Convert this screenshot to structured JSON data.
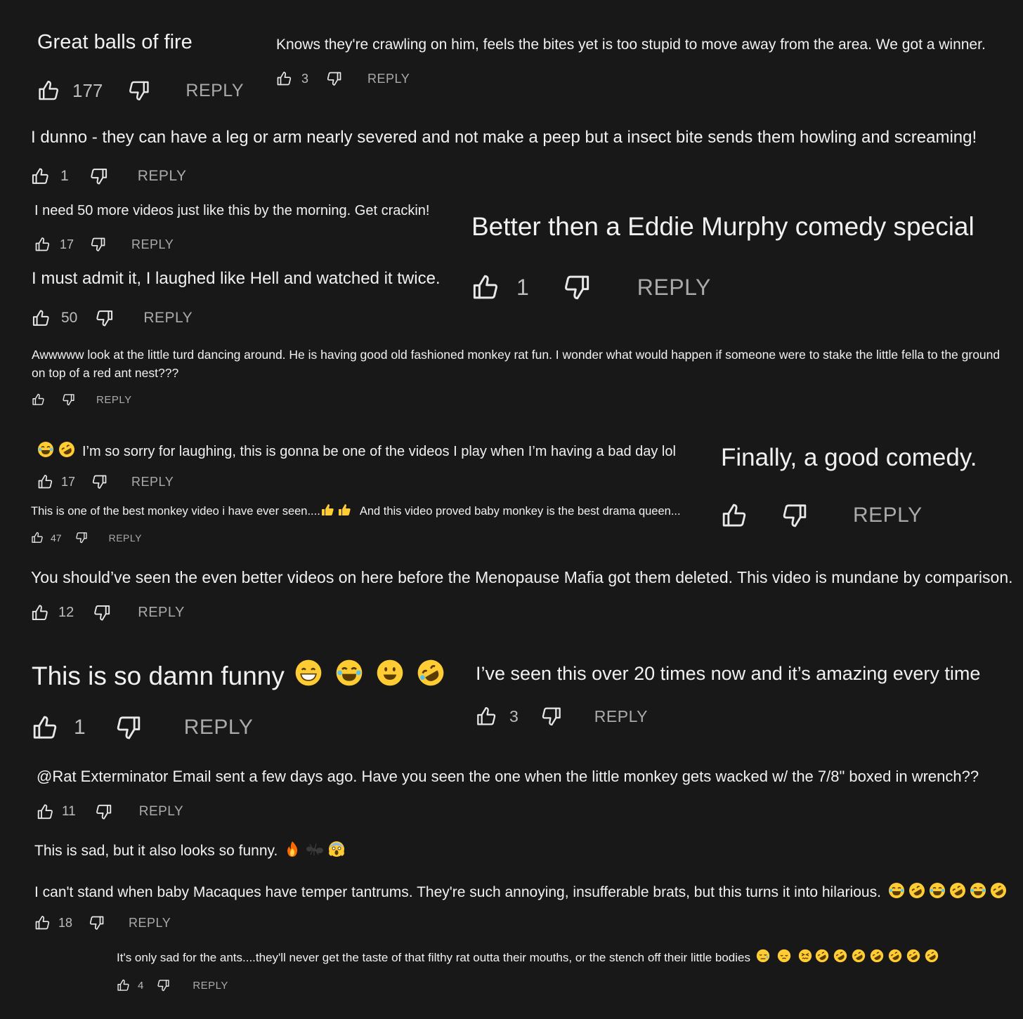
{
  "comments": {
    "c1": {
      "text": "Great balls of fire",
      "likes": "177",
      "reply": "REPLY"
    },
    "c2": {
      "text": "Knows they're crawling on him, feels the bites yet is too stupid to move away from the area. We got a winner.",
      "likes": "3",
      "reply": "REPLY"
    },
    "c3": {
      "text": "I dunno - they can have a leg or arm nearly severed and not make a peep but a insect bite sends them howling and screaming!",
      "likes": "1",
      "reply": "REPLY"
    },
    "c4": {
      "text": "I need 50 more videos just like this by the morning.  Get crackin!",
      "likes": "17",
      "reply": "REPLY"
    },
    "c5": {
      "text": "Better then a Eddie Murphy comedy special",
      "likes": "1",
      "reply": "REPLY"
    },
    "c6": {
      "text": "I must admit it, I laughed like Hell and watched it twice.",
      "likes": "50",
      "reply": "REPLY"
    },
    "c7": {
      "text": "Awwwww look at the little turd dancing around. He is having good old fashioned monkey rat fun. I wonder what would happen if someone were to stake the little fella to the ground on top of a red ant nest???",
      "reply": "REPLY"
    },
    "c8": {
      "text": "I’m so sorry for laughing, this is gonna be one of the videos I play when I’m having a bad day lol",
      "likes": "17",
      "reply": "REPLY"
    },
    "c9": {
      "text": "Finally, a good comedy.",
      "reply": "REPLY"
    },
    "c10": {
      "text_a": "This is one of the best monkey video i have ever seen....",
      "text_b": "And this video proved baby monkey is the best drama queen...",
      "likes": "47",
      "reply": "REPLY"
    },
    "c11": {
      "text": "You should’ve seen the even better videos on here before the Menopause Mafia got them deleted. This video is mundane by comparison.",
      "likes": "12",
      "reply": "REPLY"
    },
    "c12": {
      "text": "This is so damn funny",
      "likes": "1",
      "reply": "REPLY"
    },
    "c13": {
      "text": "I’ve seen this over 20 times now and it’s amazing every time",
      "likes": "3",
      "reply": "REPLY"
    },
    "c14": {
      "text": "@Rat Exterminator  Email sent a few days ago. Have you seen the one when the little monkey gets wacked w/ the 7/8\" boxed in wrench??",
      "likes": "11",
      "reply": "REPLY"
    },
    "c15": {
      "text": "This is sad, but it also looks so funny."
    },
    "c16": {
      "text": "I can't stand when baby Macaques have temper tantrums. They're such annoying, insufferable brats, but this turns it into hilarious.",
      "likes": "18",
      "reply": "REPLY"
    },
    "c17": {
      "text": "It's only sad for the ants....they'll never get the taste of that filthy rat outta their mouths, or the stench off their little bodies",
      "likes": "4",
      "reply": "REPLY"
    }
  },
  "icons": {
    "like": "thumbs-up-icon",
    "dislike": "thumbs-down-icon"
  },
  "colors": {
    "background": "#181818",
    "text": "#f1f1f1",
    "reply": "#aaaaaa",
    "emoji": "#ffcc33"
  }
}
